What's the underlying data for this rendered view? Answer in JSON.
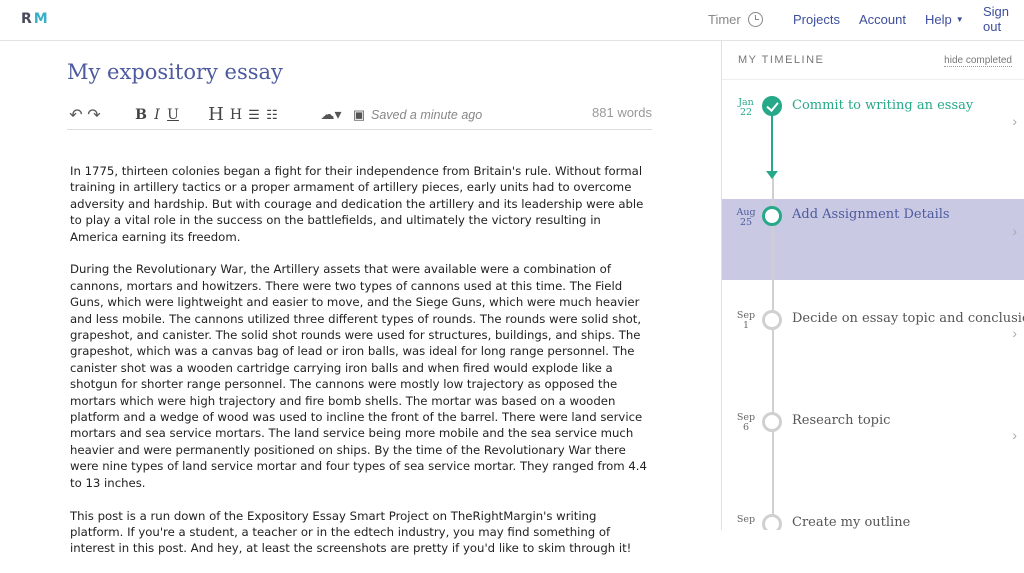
{
  "header": {
    "logo_r": "R",
    "logo_m": "M",
    "timer_label": "Timer",
    "projects": "Projects",
    "account": "Account",
    "help": "Help",
    "signout": "Sign out"
  },
  "editor": {
    "title": "My expository essay",
    "saved_status": "Saved a minute ago",
    "word_count": "881 words",
    "toolbar": {
      "bold": "B",
      "italic": "I",
      "underline": "U",
      "heading1": "H",
      "heading2": "H"
    },
    "paragraphs": [
      "In 1775, thirteen colonies began a fight for their independence from Britain's rule. Without formal training in artillery tactics or a proper armament of artillery pieces, early units had to overcome adversity and hardship. But with courage and dedication the artillery and its leadership were able to play a vital role in the success on the battlefields, and ultimately the victory resulting in America earning its freedom.",
      "During the Revolutionary War, the Artillery assets that were available were a combination of cannons, mortars and howitzers. There were two types of cannons used at this time. The Field Guns, which were lightweight and easier to move, and the Siege Guns, which were much heavier and less mobile. The cannons utilized three different types of rounds. The rounds were solid shot, grapeshot, and canister. The solid shot rounds were used for structures, buildings, and ships. The grapeshot, which was a canvas bag of lead or iron balls, was ideal for long range personnel. The canister shot was a wooden cartridge carrying iron balls and when fired would explode like a shotgun for shorter range personnel. The cannons were mostly low trajectory as opposed the mortars which were high trajectory and fire bomb shells. The mortar was based on a wooden platform and a wedge of wood was used to incline the front of the barrel. There were land service mortars and sea service mortars. The land service being more mobile and the sea service much heavier and were permanently positioned on ships. By the time of the Revolutionary War there were nine types of land service mortar and four types of sea service mortar. They ranged from 4.4 to 13 inches.",
      "This post is a run down of the Expository Essay Smart Project on TheRightMargin's writing platform. If you're a student, a teacher or in the edtech industry, you may find something of interest in this post. And hey, at least the screenshots are pretty if you'd like to skim through it!"
    ]
  },
  "timeline": {
    "title": "MY TIMELINE",
    "hide_completed": "hide completed",
    "items": [
      {
        "month": "Jan",
        "day": "22",
        "label": "Commit to writing an essay",
        "state": "done"
      },
      {
        "month": "Aug",
        "day": "25",
        "label": "Add Assignment Details",
        "state": "current"
      },
      {
        "month": "Sep",
        "day": "1",
        "label": "Decide on essay topic and conclusion",
        "state": "pending"
      },
      {
        "month": "Sep",
        "day": "6",
        "label": "Research topic",
        "state": "pending"
      },
      {
        "month": "Sep",
        "day": "",
        "label": "Create my outline",
        "state": "pending"
      }
    ]
  },
  "colors": {
    "accent_blue": "#4e5a9e",
    "accent_green": "#26a889",
    "active_row": "#c9c9e3"
  }
}
